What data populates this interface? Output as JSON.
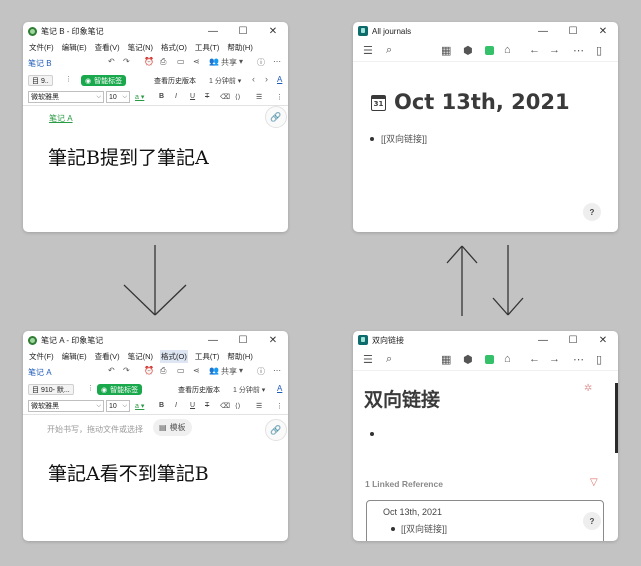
{
  "evernote_b": {
    "title": "笔记 B - 印象笔记",
    "menu": [
      "文件(F)",
      "编辑(E)",
      "查看(V)",
      "笔记(N)",
      "格式(O)",
      "工具(T)",
      "帮助(H)"
    ],
    "notebook": "笔记 B",
    "notebook_chip": "目 9..",
    "smart_label": "智能标签",
    "history": "查看历史版本",
    "time": "1 分钟前",
    "share": "共享",
    "font": "微软雅黑",
    "size": "10",
    "link_text": "笔记 A",
    "body": "筆記B提到了筆記A"
  },
  "evernote_a": {
    "title": "笔记 A - 印象笔记",
    "menu": [
      "文件(F)",
      "编辑(E)",
      "查看(V)",
      "笔记(N)",
      "格式(O)",
      "工具(T)",
      "帮助(H)"
    ],
    "notebook": "笔记 A",
    "notebook_chip": "目 910- 默...",
    "smart_label": "智能标签",
    "history": "查看历史版本",
    "time": "1 分钟前",
    "share": "共享",
    "font": "微软雅黑",
    "size": "10",
    "placeholder": "开始书写，拖动文件或选择",
    "template": "模板",
    "body": "筆記A看不到筆記B"
  },
  "logseq_journals": {
    "title": "All journals",
    "calendar_day": "31",
    "page_title": "Oct 13th, 2021",
    "block": "[[双向链接]]",
    "help": "?"
  },
  "logseq_page": {
    "title": "双向链接",
    "page_title": "双向链接",
    "linked_refs": "1 Linked Reference",
    "ref_date": "Oct 13th, 2021",
    "ref_block": "[[双向链接]]",
    "help": "?"
  },
  "window_controls": {
    "min": "—",
    "max": "☐",
    "close": "✕"
  },
  "colors": {
    "accent_green": "#19a84b",
    "link_blue": "#1e5bb8",
    "logseq_green": "#35c06a",
    "filter_red": "#e0706a"
  }
}
